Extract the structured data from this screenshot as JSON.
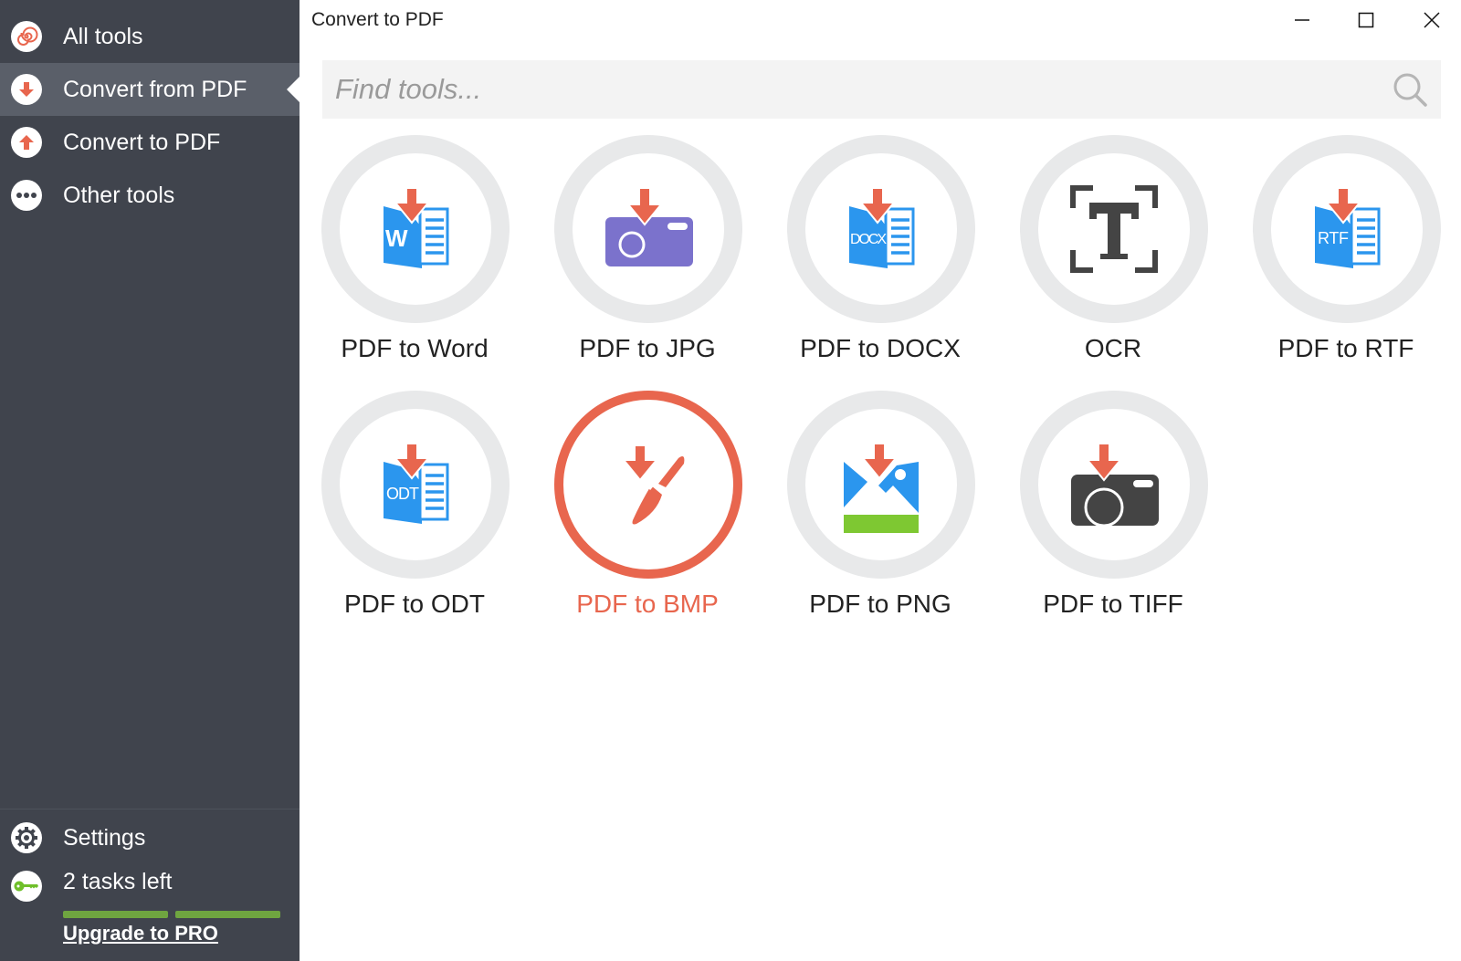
{
  "window": {
    "title": "Convert to PDF",
    "controls": {
      "minimize": "minimize",
      "maximize": "maximize",
      "close": "close"
    }
  },
  "sidebar": {
    "items": [
      {
        "label": "All tools",
        "icon": "spiral-icon",
        "active": false
      },
      {
        "label": "Convert from PDF",
        "icon": "arrow-down-icon",
        "active": true
      },
      {
        "label": "Convert to PDF",
        "icon": "arrow-up-icon",
        "active": false
      },
      {
        "label": "Other tools",
        "icon": "dots-icon",
        "active": false
      }
    ],
    "settings_label": "Settings",
    "tasks_label": "2 tasks left",
    "tasks_remaining_fraction": 1.0,
    "upgrade_label": "Upgrade to PRO"
  },
  "search": {
    "placeholder": "Find tools...",
    "value": ""
  },
  "tools": [
    {
      "label": "PDF to Word",
      "icon": "word-doc-icon",
      "badge": "W",
      "selected": false
    },
    {
      "label": "PDF to JPG",
      "icon": "jpg-camera-icon",
      "selected": false
    },
    {
      "label": "PDF to DOCX",
      "icon": "docx-doc-icon",
      "badge": "DOCX",
      "selected": false
    },
    {
      "label": "OCR",
      "icon": "ocr-text-icon",
      "selected": false
    },
    {
      "label": "PDF to RTF",
      "icon": "rtf-doc-icon",
      "badge": "RTF",
      "selected": false
    },
    {
      "label": "PDF to ODT",
      "icon": "odt-doc-icon",
      "badge": "ODT",
      "selected": false
    },
    {
      "label": "PDF to BMP",
      "icon": "bmp-brush-icon",
      "selected": true
    },
    {
      "label": "PDF to PNG",
      "icon": "png-image-icon",
      "selected": false
    },
    {
      "label": "PDF to TIFF",
      "icon": "tiff-camera-icon",
      "selected": false
    }
  ],
  "colors": {
    "sidebar_bg": "#40444d",
    "sidebar_active": "#5a5f69",
    "accent": "#e8664e",
    "doc_blue": "#2b96ee",
    "jpg_purple": "#7b72cc",
    "png_green": "#7ec832",
    "progress_green": "#6fa540",
    "key_green": "#6fbf2a",
    "dark_icon": "#444444"
  }
}
